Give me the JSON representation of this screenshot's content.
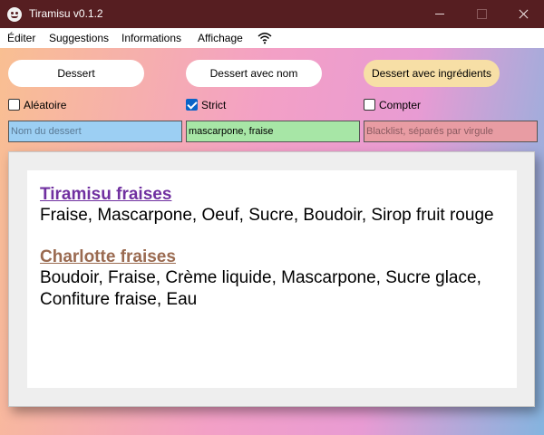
{
  "window": {
    "title": "Tiramisu v0.1.2",
    "icon": "tiramisu-app-icon"
  },
  "menu": {
    "items": [
      "Éditer",
      "Suggestions",
      "Informations",
      "Affichage"
    ],
    "wifi_icon": "wifi-icon"
  },
  "buttons": {
    "dessert": "Dessert",
    "dessert_name": "Dessert avec nom",
    "dessert_ingredients": "Dessert avec ingrédients"
  },
  "checkboxes": {
    "random": {
      "label": "Aléatoire",
      "checked": false
    },
    "strict": {
      "label": "Strict",
      "checked": true
    },
    "count": {
      "label": "Compter",
      "checked": false
    }
  },
  "fields": {
    "name": {
      "value": "",
      "placeholder": "Nom du dessert"
    },
    "ingredients": {
      "value": "mascarpone, fraise"
    },
    "blacklist": {
      "value": "",
      "placeholder": "Blacklist, séparés par virgule"
    }
  },
  "results": [
    {
      "title": "Tiramisu fraises",
      "title_color": "#7030a0",
      "ingredients": "Fraise, Mascarpone, Oeuf, Sucre, Boudoir, Sirop fruit rouge"
    },
    {
      "title": "Charlotte fraises",
      "title_color": "#9a6a50",
      "ingredients": "Boudoir, Fraise, Crème liquide, Mascarpone, Sucre glace, Confiture fraise, Eau"
    }
  ]
}
